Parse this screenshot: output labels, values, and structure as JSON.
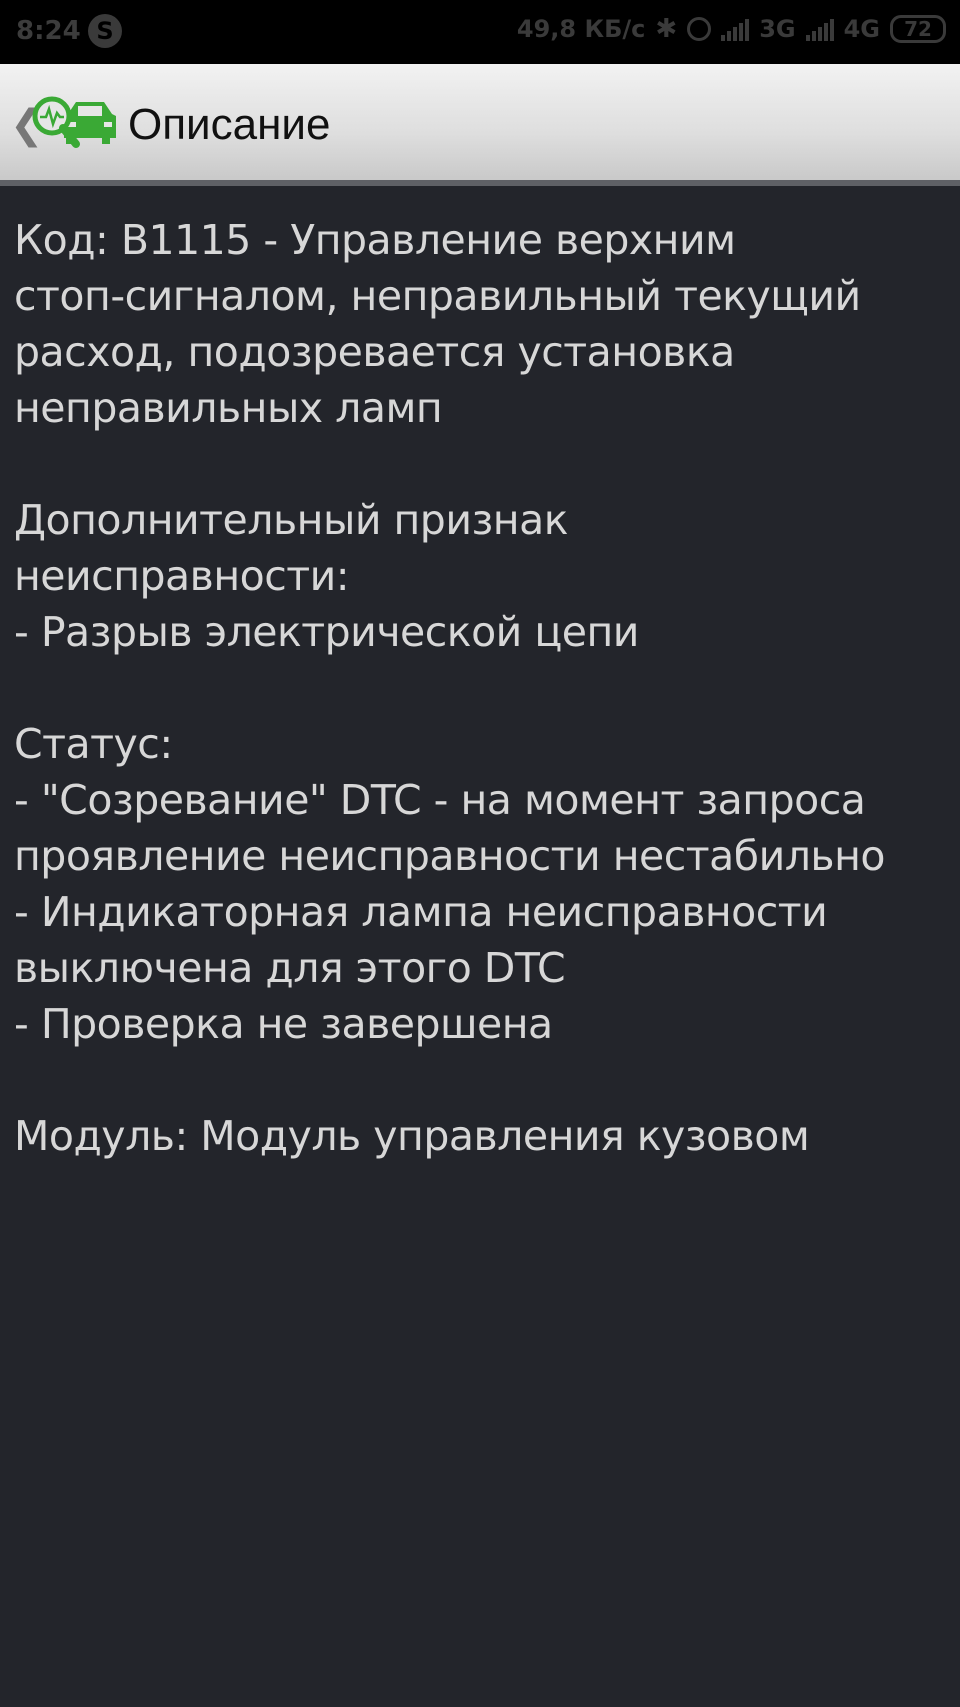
{
  "status_bar": {
    "time": "8:24",
    "network_speed": "49,8 КБ/с",
    "net_3g": "3G",
    "net_4g": "4G",
    "battery": "72",
    "icons": [
      "skype-icon",
      "bluetooth-icon",
      "alarm-icon",
      "signal-icon",
      "battery-icon"
    ]
  },
  "app_bar": {
    "title": "Описание",
    "logo_color": "#3aa935"
  },
  "description": {
    "code_line": "Код: B1115 - Управление верхним\nстоп-сигналом, неправильный текущий\nрасход, подозревается установка\nнеправильных ламп",
    "extra_sign_block": "Дополнительный признак\nнеисправности:\n - Разрыв электрической цепи",
    "status_block": "Статус:\n - \"Созревание\" DTC - на момент запроса\nпроявление неисправности нестабильно\n - Индикаторная лампа неисправности\nвыключена для этого DTC\n - Проверка не завершена",
    "module_line": "Модуль: Модуль управления кузовом"
  },
  "colors": {
    "background": "#23252b",
    "text": "#d7d7d7",
    "app_bar": "#dedede",
    "accent_green": "#3aa935"
  }
}
